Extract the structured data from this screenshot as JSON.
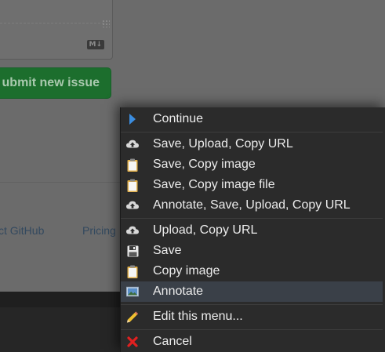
{
  "background": {
    "markdown_badge": "M↓",
    "submit_button_label": "ubmit new issue",
    "footer_links": [
      "ct GitHub",
      "Pricing"
    ]
  },
  "menu": {
    "items": [
      {
        "label": "Continue",
        "icon": "play-arrow-icon"
      },
      {
        "label": "Save, Upload, Copy URL",
        "icon": "cloud-upload-icon"
      },
      {
        "label": "Save, Copy image",
        "icon": "clipboard-icon"
      },
      {
        "label": "Save, Copy image file",
        "icon": "clipboard-icon"
      },
      {
        "label": "Annotate, Save, Upload, Copy URL",
        "icon": "cloud-upload-icon"
      },
      {
        "label": "Upload, Copy URL",
        "icon": "cloud-upload-icon"
      },
      {
        "label": "Save",
        "icon": "floppy-disk-icon"
      },
      {
        "label": "Copy image",
        "icon": "clipboard-icon"
      },
      {
        "label": "Annotate",
        "icon": "image-frame-icon"
      },
      {
        "label": "Edit this menu...",
        "icon": "pencil-icon"
      },
      {
        "label": "Cancel",
        "icon": "red-x-icon"
      }
    ],
    "highlighted_item": "Annotate"
  },
  "colors": {
    "menu_background": "#2b2b2b",
    "highlight": "#3a4048",
    "submit_green": "#1c6e2d",
    "cancel_red": "#e02020"
  }
}
